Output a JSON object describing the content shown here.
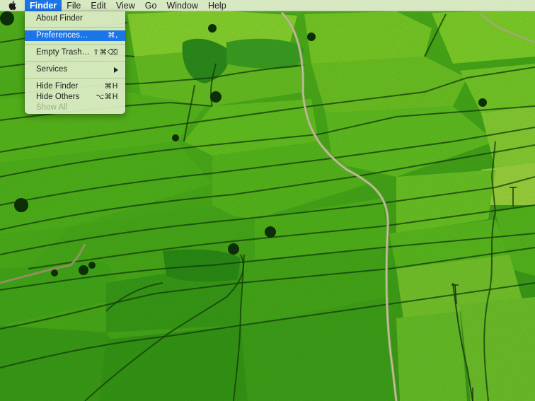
{
  "menubar": {
    "apple_icon": "apple-logo-icon",
    "items": [
      {
        "label": "Finder",
        "active": true
      },
      {
        "label": "File"
      },
      {
        "label": "Edit"
      },
      {
        "label": "View"
      },
      {
        "label": "Go"
      },
      {
        "label": "Window"
      },
      {
        "label": "Help"
      }
    ]
  },
  "finder_menu": {
    "items": [
      {
        "label": "About Finder",
        "shortcut": ""
      },
      {
        "label": "Preferences…",
        "shortcut": "⌘,",
        "highlighted": true
      },
      {
        "label": "Empty Trash…",
        "shortcut": "⇧⌘⌫"
      },
      {
        "label": "Services",
        "submenu_icon": "triangle-right-icon"
      },
      {
        "label": "Hide Finder",
        "shortcut": "⌘H"
      },
      {
        "label": "Hide Others",
        "shortcut": "⌥⌘H"
      },
      {
        "label": "Show All",
        "shortcut": "",
        "disabled": true
      }
    ]
  },
  "colors": {
    "highlight": "#1b74e8",
    "menubar_bg": "#e2eed0",
    "field_light": "#8fd630",
    "field_mid": "#4fae1c",
    "field_dark": "#2e8a14"
  },
  "wallpaper": {
    "description": "aerial view of terraced green rice fields"
  }
}
